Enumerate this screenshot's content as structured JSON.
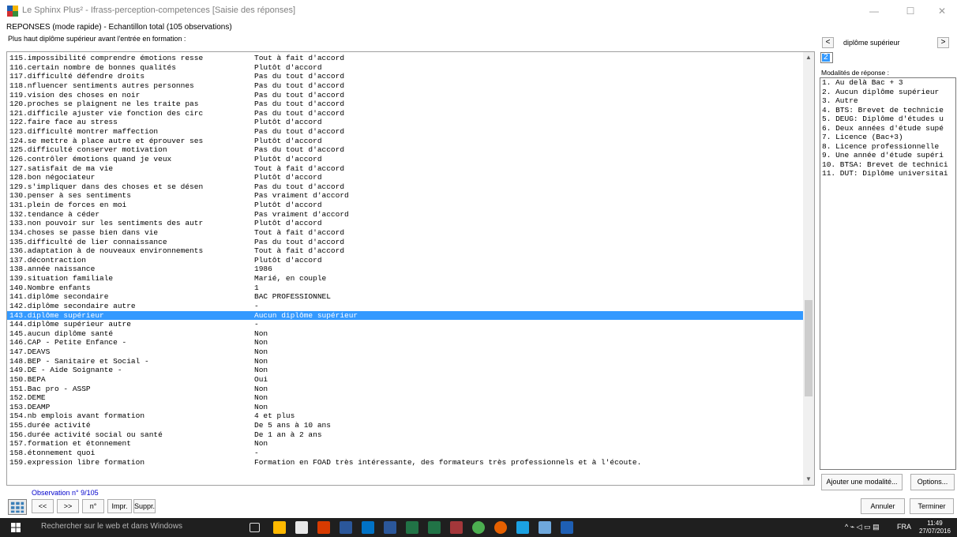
{
  "window": {
    "title": "Le Sphinx Plus² - Ifrass-perception-competences [Saisie des réponses]",
    "minimize": "—",
    "maximize": "☐",
    "close": "✕"
  },
  "subtitle": "REPONSES (mode rapide) - Echantillon total (105 observations)",
  "question_label": "Plus haut diplôme supérieur avant l'entrée en formation :",
  "responses": [
    {
      "q": "115.impossibilité comprendre émotions resse",
      "a": "Tout à fait d'accord"
    },
    {
      "q": "116.certain nombre de bonnes qualités",
      "a": "Plutôt d'accord"
    },
    {
      "q": "117.difficulté défendre droits",
      "a": "Pas du tout d'accord"
    },
    {
      "q": "118.nfluencer sentiments autres personnes",
      "a": "Pas du tout d'accord"
    },
    {
      "q": "119.vision des choses en noir",
      "a": "Pas du tout d'accord"
    },
    {
      "q": "120.proches se plaignent ne les traite pas",
      "a": "Pas du tout d'accord"
    },
    {
      "q": "121.difficile ajuster vie fonction des circ",
      "a": "Pas du tout d'accord"
    },
    {
      "q": "122.faire face au stress",
      "a": "Plutôt d'accord"
    },
    {
      "q": "123.difficulté montrer maffection",
      "a": "Pas du tout d'accord"
    },
    {
      "q": "124.se mettre à place autre et éprouver ses",
      "a": "Plutôt d'accord"
    },
    {
      "q": "125.difficulté conserver motivation",
      "a": "Pas du tout d'accord"
    },
    {
      "q": "126.contrôler émotions quand je veux",
      "a": "Plutôt d'accord"
    },
    {
      "q": "127.satisfait de ma vie",
      "a": "Tout à fait d'accord"
    },
    {
      "q": "128.bon négociateur",
      "a": "Plutôt d'accord"
    },
    {
      "q": "129.s'impliquer dans des choses et se désen",
      "a": "Pas du tout d'accord"
    },
    {
      "q": "130.penser à ses sentiments",
      "a": "Pas vraiment d'accord"
    },
    {
      "q": "131.plein de forces en moi",
      "a": "Plutôt d'accord"
    },
    {
      "q": "132.tendance à céder",
      "a": "Pas vraiment d'accord"
    },
    {
      "q": "133.non pouvoir sur les sentiments des autr",
      "a": "Plutôt d'accord"
    },
    {
      "q": "134.choses se passe bien dans vie",
      "a": "Tout à fait d'accord"
    },
    {
      "q": "135.difficulté de lier connaissance",
      "a": "Pas du tout d'accord"
    },
    {
      "q": "136.adaptation à de nouveaux environnements",
      "a": "Tout à fait d'accord"
    },
    {
      "q": "137.décontraction",
      "a": "Plutôt d'accord"
    },
    {
      "q": "138.année naissance",
      "a": "1986"
    },
    {
      "q": "139.situation familiale",
      "a": "Marié, en couple"
    },
    {
      "q": "140.Nombre enfants",
      "a": "1"
    },
    {
      "q": "141.diplôme secondaire",
      "a": "BAC PROFESSIONNEL"
    },
    {
      "q": "142.diplôme secondaire autre",
      "a": "-"
    },
    {
      "q": "143.diplôme supérieur",
      "a": "Aucun diplôme supérieur",
      "selected": true
    },
    {
      "q": "144.diplôme supérieur autre",
      "a": "-"
    },
    {
      "q": "145.aucun diplôme santé",
      "a": "Non"
    },
    {
      "q": "146.CAP - Petite Enfance -",
      "a": "Non"
    },
    {
      "q": "147.DEAVS",
      "a": "Non"
    },
    {
      "q": "148.BEP - Sanitaire et Social -",
      "a": "Non"
    },
    {
      "q": "149.DE - Aide Soignante -",
      "a": "Non"
    },
    {
      "q": "150.BEPA",
      "a": "Oui"
    },
    {
      "q": "151.Bac pro - ASSP",
      "a": "Non"
    },
    {
      "q": "152.DEME",
      "a": "Non"
    },
    {
      "q": "153.DEAMP",
      "a": "Non"
    },
    {
      "q": "154.nb emplois avant formation",
      "a": "4 et plus"
    },
    {
      "q": "155.durée activité",
      "a": "De 5 ans à 10 ans"
    },
    {
      "q": "156.durée activité social ou santé",
      "a": "De 1 an à 2 ans"
    },
    {
      "q": "157.formation et étonnement",
      "a": "Non"
    },
    {
      "q": "158.étonnement quoi",
      "a": "-"
    },
    {
      "q": "159.expression libre formation",
      "a": "Formation en FOAD très intéressante, des formateurs très professionnels et à l'écoute."
    }
  ],
  "right_panel": {
    "prev": "<",
    "next": ">",
    "variable": "diplôme supérieur",
    "code": "2",
    "modalities_label": "Modalités de réponse :",
    "modalities": [
      " 1. Au delà Bac + 3",
      " 2. Aucun diplôme supérieur",
      " 3. Autre",
      " 4. BTS: Brevet de technicie",
      " 5. DEUG: Diplôme d'études u",
      " 6. Deux années d'étude supé",
      " 7. Licence (Bac+3)",
      " 8. Licence professionnelle",
      " 9. Une année d'étude supéri",
      "10. BTSA: Brevet de technici",
      "11. DUT: Diplôme universitai"
    ],
    "add_button": "Ajouter une modalité...",
    "options_button": "Options..."
  },
  "bottom": {
    "observation": "Observation n° 9/105",
    "first": "<<",
    "last": ">>",
    "number": "n°",
    "print": "Impr.",
    "delete": "Suppr.",
    "cancel": "Annuler",
    "finish": "Terminer"
  },
  "taskbar": {
    "search": "Rechercher sur le web et dans Windows",
    "lang": "FRA",
    "time": "11:49",
    "date": "27/07/2016"
  }
}
